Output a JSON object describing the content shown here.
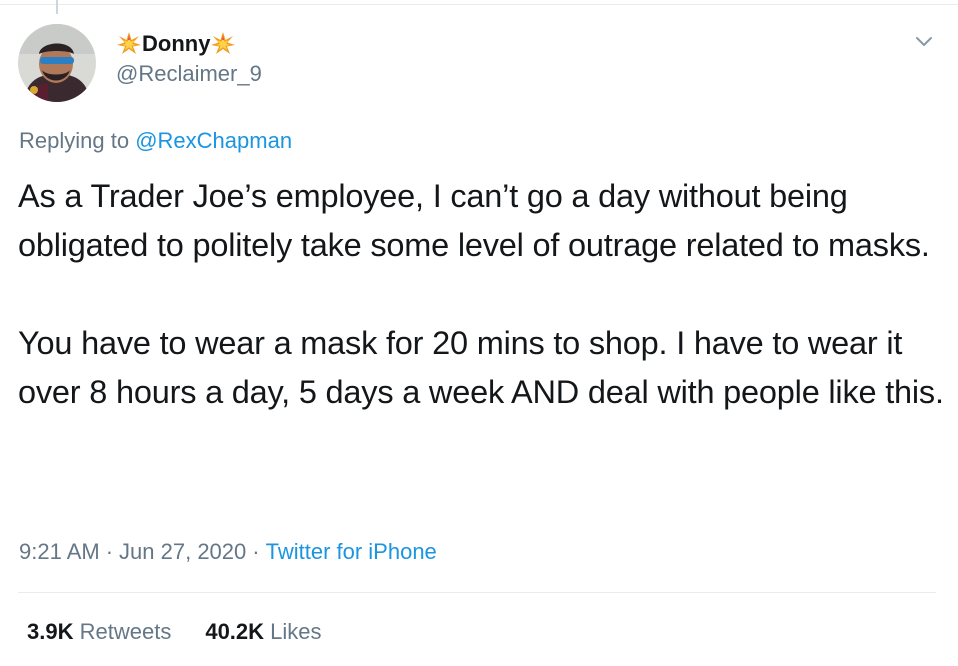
{
  "tweet": {
    "author": {
      "display_name": "Donny",
      "handle": "@Reclaimer_9",
      "avatar_icon": "user-avatar",
      "name_decoration_icon": "sparkle-emoji-icon"
    },
    "replying_prefix": "Replying to",
    "replying_to": "@RexChapman",
    "body": {
      "paragraph_1": "As a Trader Joe’s employee, I can’t go a day without being obligated to politely take some level of outrage related to masks.",
      "paragraph_2": "You have to wear a mask for 20 mins to shop. I have to wear it over 8 hours a day, 5 days a week AND deal with people like this."
    },
    "meta": {
      "time": "9:21 AM",
      "separator": "·",
      "date": "Jun 27, 2020",
      "source": "Twitter for iPhone"
    },
    "stats": {
      "retweets_count": "3.9K",
      "retweets_label": "Retweets",
      "likes_count": "40.2K",
      "likes_label": "Likes"
    }
  },
  "colors": {
    "text_primary": "#14171a",
    "text_secondary": "#657786",
    "link": "#1b95e0",
    "divider": "#e6ecf0"
  }
}
